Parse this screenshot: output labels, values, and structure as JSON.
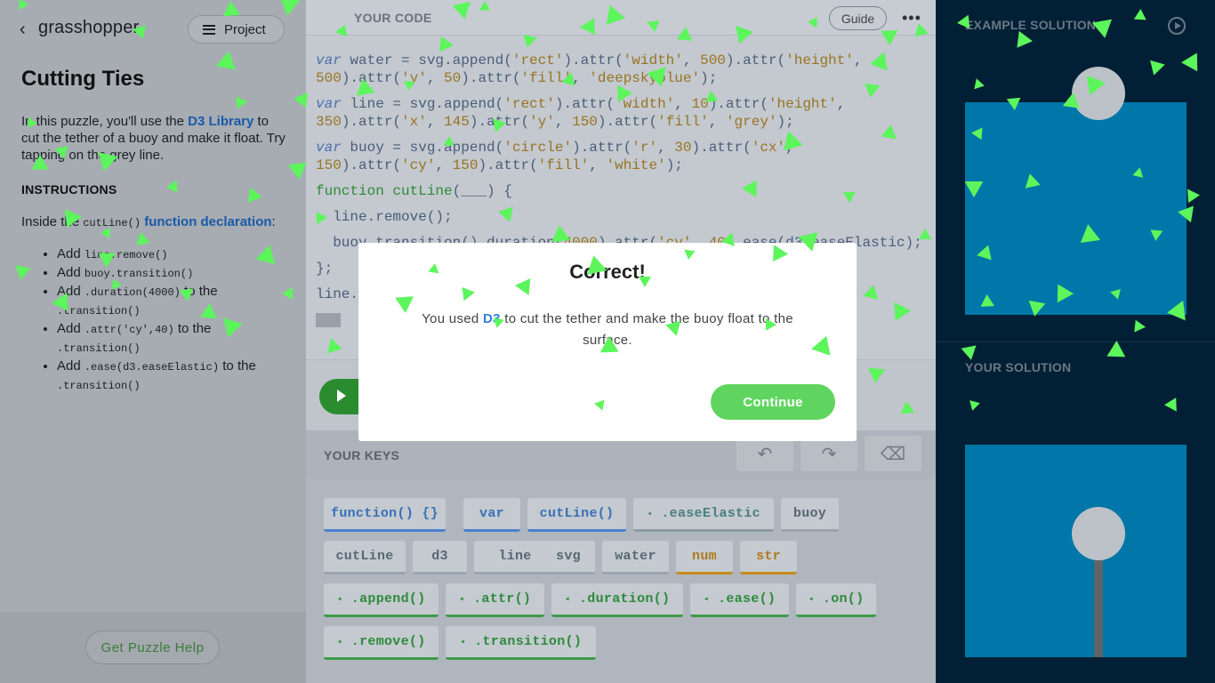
{
  "left": {
    "logo": "grasshopper",
    "project_label": "Project",
    "title": "Cutting Ties",
    "intro_pre": "In this puzzle, you'll use the ",
    "intro_link": "D3 Library",
    "intro_post": " to cut the tether of a buoy and make it float. Try tapping on the grey line.",
    "instructions_heading": "INSTRUCTIONS",
    "inside_pre": "Inside the ",
    "inside_code": "cutLine()",
    "inside_link": "function declaration",
    "inside_post": ":",
    "steps": [
      {
        "pre": "Add ",
        "code": "line.remove()",
        "post": ""
      },
      {
        "pre": "Add ",
        "code": "buoy.transition()",
        "post": ""
      },
      {
        "pre": "Add ",
        "code": ".duration(4000)",
        "post": " to the ",
        "code2": ".transition()"
      },
      {
        "pre": "Add ",
        "code": ".attr('cy',40)",
        "post": " to the ",
        "code2": ".transition()"
      },
      {
        "pre": "Add ",
        "code": ".ease(d3.easeElastic)",
        "post": " to the ",
        "code2": ".transition()"
      }
    ],
    "help_label": "Get Puzzle Help"
  },
  "editor": {
    "heading": "YOUR CODE",
    "guide_label": "Guide",
    "more_label": "•••",
    "keys_heading": "YOUR KEYS"
  },
  "keys": [
    {
      "label": "function() {}",
      "style": "blue"
    },
    {
      "label": "var",
      "style": "blue"
    },
    {
      "label": "cutLine()",
      "style": "blue"
    },
    {
      "label": ".easeElastic",
      "style": "teal",
      "chev": true
    },
    {
      "label": "buoy",
      "style": "grey"
    },
    {
      "label": "cutLine",
      "style": "grey"
    },
    {
      "label": "d3",
      "style": "grey"
    },
    {
      "label": "line",
      "style": "grey"
    },
    {
      "label": "svg",
      "style": "grey"
    },
    {
      "label": "water",
      "style": "grey"
    },
    {
      "label": "num",
      "style": "orange"
    },
    {
      "label": "str",
      "style": "orange"
    },
    {
      "label": ".append()",
      "style": "green",
      "chev": true
    },
    {
      "label": ".attr()",
      "style": "green",
      "chev": true
    },
    {
      "label": ".duration()",
      "style": "green",
      "chev": true
    },
    {
      "label": ".ease()",
      "style": "green",
      "chev": true
    },
    {
      "label": ".on()",
      "style": "green",
      "chev": true
    },
    {
      "label": ".remove()",
      "style": "green",
      "chev": true
    },
    {
      "label": ".transition()",
      "style": "green",
      "chev": true
    }
  ],
  "right": {
    "example_label": "EXAMPLE SOLUTION",
    "your_label": "YOUR SOLUTION"
  },
  "modal": {
    "title": "Correct!",
    "msg_pre": "You used ",
    "msg_link": "D3",
    "msg_post": " to cut the tether and make the buoy float to the surface.",
    "continue_label": "Continue"
  },
  "colors": {
    "water": "#0077a8",
    "buoy": "#bcc2c8",
    "tether": "#5f6468",
    "confetti": "#5cf55c",
    "continue": "#5fd55f"
  }
}
